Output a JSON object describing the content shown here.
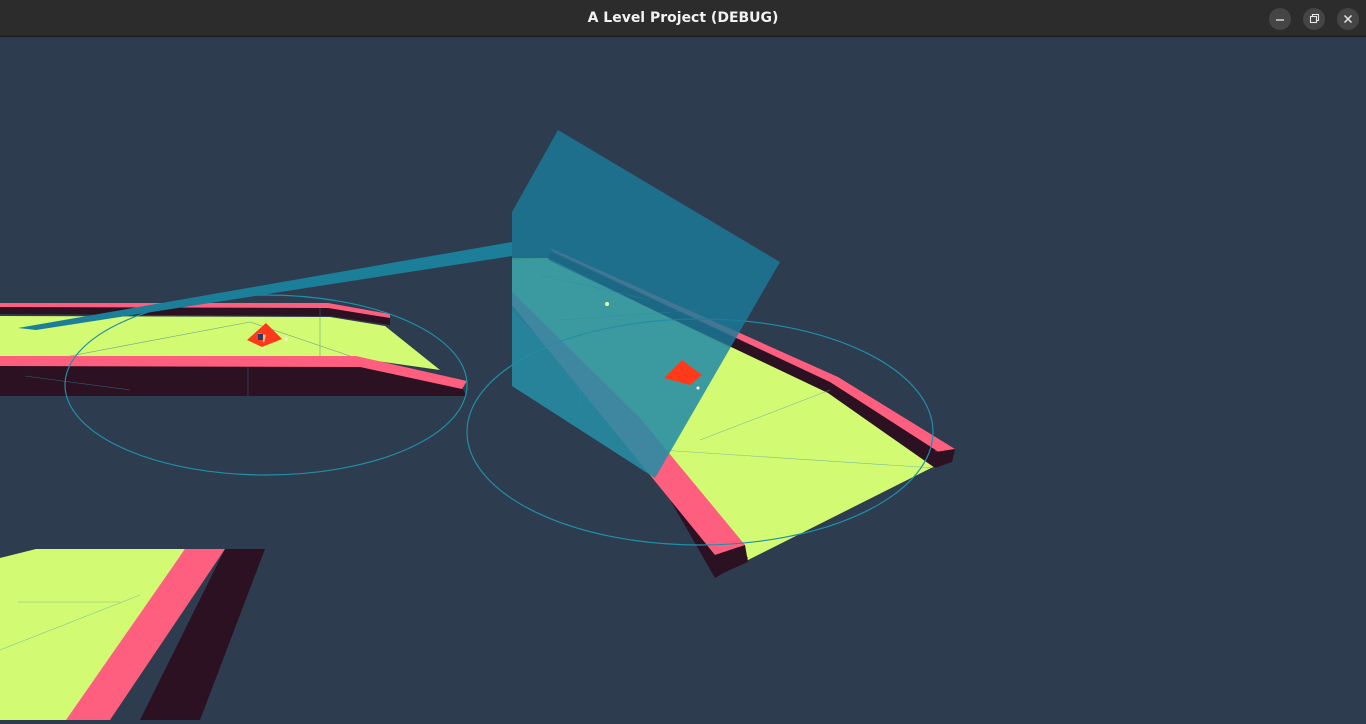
{
  "window": {
    "title": "A Level Project (DEBUG)",
    "controls": [
      "minimize-icon",
      "restore-icon",
      "close-icon"
    ]
  },
  "colors": {
    "background": "#2e3c4f",
    "floor": "#d2fb73",
    "wall_top": "#ff5f7e",
    "wall_side": "#2b1121",
    "debug_gizmo": "#1f8fa8",
    "player_marker": "#ff3a1a"
  }
}
